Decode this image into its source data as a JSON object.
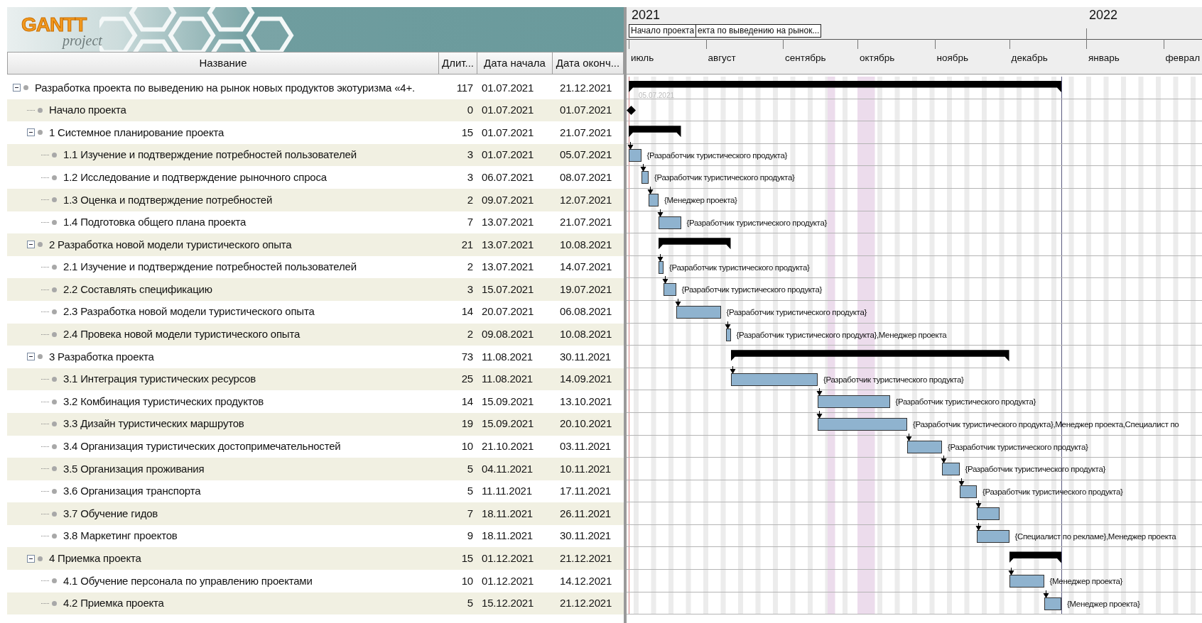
{
  "logo": {
    "title": "GANTT",
    "subtitle": "project"
  },
  "columns": [
    {
      "label": "Название"
    },
    {
      "label": "Длит..."
    },
    {
      "label": "Дата начала"
    },
    {
      "label": "Дата оконч..."
    }
  ],
  "timeline": {
    "years": [
      {
        "label": "2021"
      },
      {
        "label": "2022"
      }
    ],
    "captions": [
      "Начало проекта",
      "екта по выведению на рынок..."
    ],
    "months": [
      {
        "label": "июль"
      },
      {
        "label": "август"
      },
      {
        "label": "сентябрь"
      },
      {
        "label": "октябрь"
      },
      {
        "label": "ноябрь"
      },
      {
        "label": "декабрь"
      },
      {
        "label": "январь"
      },
      {
        "label": "феврал"
      }
    ]
  },
  "tasks": [
    {
      "name": "Разработка проекта по выведению на рынок новых продуктов экотуризма «4+.",
      "kind": "summary",
      "expanded": true,
      "linked": false,
      "duration": "117",
      "start": "01.07.2021",
      "end": "21.12.2021",
      "date_hint": "05.07.2021",
      "children": [
        {
          "name": "Начало проекта",
          "kind": "milestone",
          "linked": false,
          "duration": "0",
          "start": "01.07.2021",
          "end": "01.07.2021"
        },
        {
          "name": "1 Системное планирование проекта",
          "kind": "summary",
          "expanded": true,
          "linked": false,
          "duration": "15",
          "start": "01.07.2021",
          "end": "21.07.2021",
          "children": [
            {
              "name": "1.1 Изучение и подтверждение потребностей пользователей",
              "kind": "task",
              "linked": true,
              "duration": "3",
              "start": "01.07.2021",
              "end": "05.07.2021",
              "resources": "{Разработчик туристического продукта}"
            },
            {
              "name": "1.2 Исследование и подтверждение рыночного спроса",
              "kind": "task",
              "linked": true,
              "duration": "3",
              "start": "06.07.2021",
              "end": "08.07.2021",
              "resources": "{Разработчик туристического продукта}"
            },
            {
              "name": "1.3 Оценка и подтверждение потребностей",
              "kind": "task",
              "linked": true,
              "duration": "2",
              "start": "09.07.2021",
              "end": "12.07.2021",
              "resources": "{Менеджер проекта}"
            },
            {
              "name": "1.4 Подготовка общего плана проекта",
              "kind": "task",
              "linked": true,
              "duration": "7",
              "start": "13.07.2021",
              "end": "21.07.2021",
              "resources": "{Разработчик туристического продукта}"
            }
          ]
        },
        {
          "name": "2 Разработка новой модели туристического опыта",
          "kind": "summary",
          "expanded": true,
          "linked": false,
          "duration": "21",
          "start": "13.07.2021",
          "end": "10.08.2021",
          "children": [
            {
              "name": "2.1 Изучение и подтверждение потребностей пользователей",
              "kind": "task",
              "linked": true,
              "duration": "2",
              "start": "13.07.2021",
              "end": "14.07.2021",
              "resources": "{Разработчик туристического продукта}"
            },
            {
              "name": "2.2 Составлять спецификацию",
              "kind": "task",
              "linked": true,
              "duration": "3",
              "start": "15.07.2021",
              "end": "19.07.2021",
              "resources": "{Разработчик туристического продукта}"
            },
            {
              "name": "2.3 Разработка новой модели туристического опыта",
              "kind": "task",
              "linked": true,
              "duration": "14",
              "start": "20.07.2021",
              "end": "06.08.2021",
              "resources": "{Разработчик туристического продукта}"
            },
            {
              "name": "2.4 Провека новой модели туристического опыта",
              "kind": "task",
              "linked": true,
              "duration": "2",
              "start": "09.08.2021",
              "end": "10.08.2021",
              "resources": "{Разработчик туристического продукта},Менеджер проекта"
            }
          ]
        },
        {
          "name": "3 Разработка проекта",
          "kind": "summary",
          "expanded": true,
          "linked": false,
          "duration": "73",
          "start": "11.08.2021",
          "end": "30.11.2021",
          "children": [
            {
              "name": "3.1 Интеграция туристических ресурсов",
              "kind": "task",
              "linked": true,
              "duration": "25",
              "start": "11.08.2021",
              "end": "14.09.2021",
              "resources": "{Разработчик туристического продукта}"
            },
            {
              "name": "3.2 Комбинация туристических продуктов",
              "kind": "task",
              "linked": true,
              "duration": "14",
              "start": "15.09.2021",
              "end": "13.10.2021",
              "resources": "{Разработчик туристического продукта}"
            },
            {
              "name": "3.3 Дизайн туристических маршрутов",
              "kind": "task",
              "linked": true,
              "duration": "19",
              "start": "15.09.2021",
              "end": "20.10.2021",
              "resources": "{Разработчик туристического продукта},Менеджер проекта,Специалист по"
            },
            {
              "name": "3.4 Организация туристических достопримечательностей",
              "kind": "task",
              "linked": true,
              "duration": "10",
              "start": "21.10.2021",
              "end": "03.11.2021",
              "resources": "{Разработчик туристического продукта}"
            },
            {
              "name": "3.5 Организация проживания",
              "kind": "task",
              "linked": true,
              "duration": "5",
              "start": "04.11.2021",
              "end": "10.11.2021",
              "resources": "{Разработчик туристического продукта}"
            },
            {
              "name": "3.6 Организация транспорта",
              "kind": "task",
              "linked": true,
              "duration": "5",
              "start": "11.11.2021",
              "end": "17.11.2021",
              "resources": "{Разработчик туристического продукта}"
            },
            {
              "name": "3.7 Обучение гидов",
              "kind": "task",
              "linked": true,
              "duration": "7",
              "start": "18.11.2021",
              "end": "26.11.2021"
            },
            {
              "name": "3.8 Маркетинг проектов",
              "kind": "task",
              "linked": true,
              "duration": "9",
              "start": "18.11.2021",
              "end": "30.11.2021",
              "resources": "{Специалист по рекламе},Менеджер проекта"
            }
          ]
        },
        {
          "name": "4 Приемка проекта",
          "kind": "summary",
          "expanded": true,
          "linked": false,
          "duration": "15",
          "start": "01.12.2021",
          "end": "21.12.2021",
          "children": [
            {
              "name": "4.1 Обучение персонала по управлению проектами",
              "kind": "task",
              "linked": true,
              "duration": "10",
              "start": "01.12.2021",
              "end": "14.12.2021",
              "resources": "{Менеджер проекта}"
            },
            {
              "name": "4.2 Приемка проекта",
              "kind": "task",
              "linked": true,
              "duration": "5",
              "start": "15.12.2021",
              "end": "21.12.2021",
              "resources": "{Менеджер проекта}"
            }
          ]
        }
      ]
    }
  ]
}
